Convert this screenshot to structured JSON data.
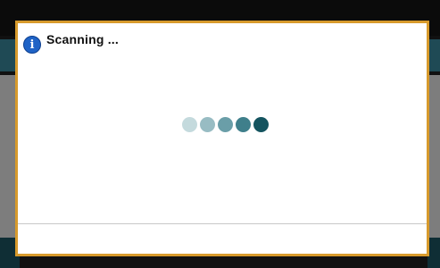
{
  "dialog": {
    "title": "Scanning ...",
    "icon": "info-icon",
    "border_color": "#d79a2c"
  },
  "loader": {
    "dot_colors": [
      "#c4dadd",
      "#98bcc3",
      "#6a9ea8",
      "#3f7f8b",
      "#14545f"
    ]
  }
}
